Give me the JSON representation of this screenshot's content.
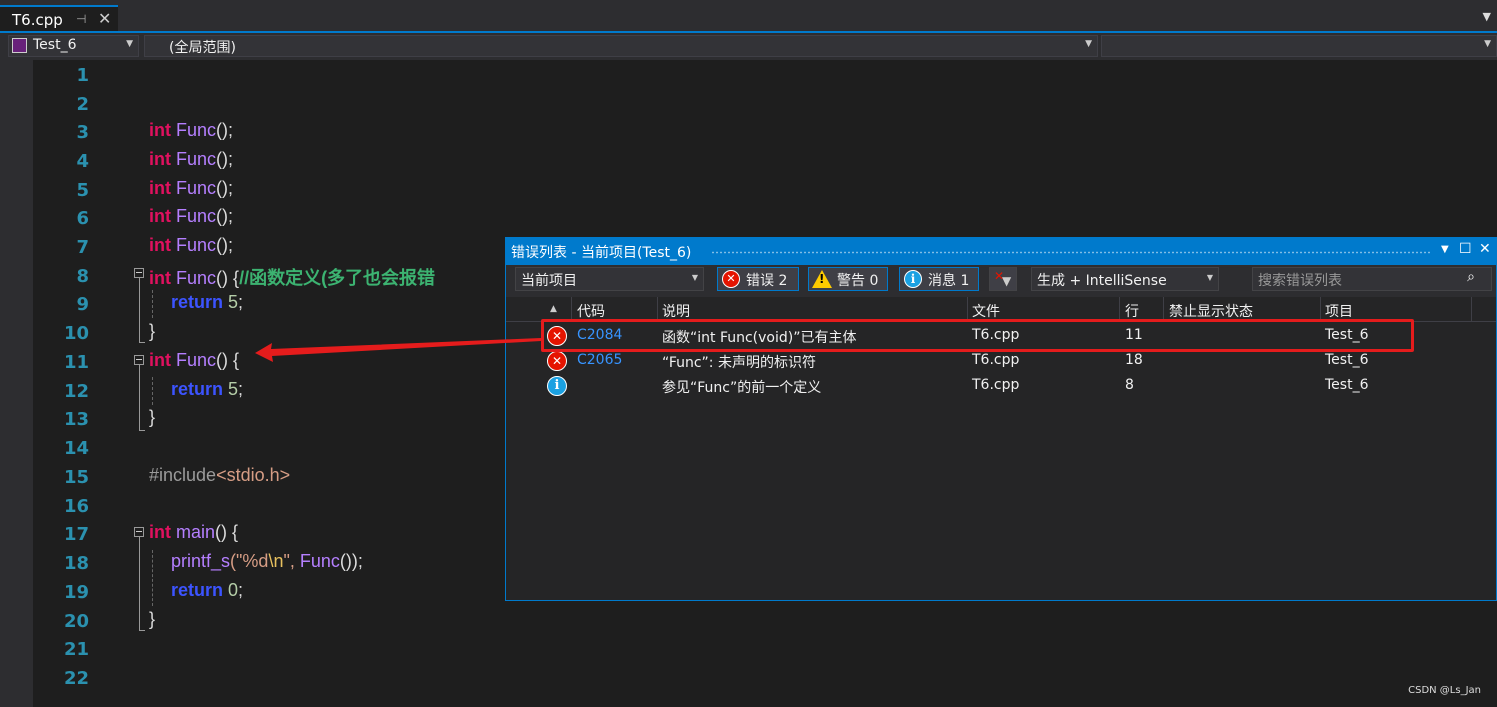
{
  "tab": {
    "title": "T6.cpp",
    "pin": "⊣",
    "close": "✕"
  },
  "nav": {
    "project": "Test_6",
    "scope": "(全局范围)",
    "member": ""
  },
  "lines": [
    "1",
    "2",
    "3",
    "4",
    "5",
    "6",
    "7",
    "8",
    "9",
    "10",
    "11",
    "12",
    "13",
    "14",
    "15",
    "16",
    "17",
    "18",
    "19",
    "20",
    "21",
    "22"
  ],
  "code": {
    "l3": {
      "kw": "int",
      "fn": "Func",
      "rest": "();"
    },
    "l4": {
      "kw": "int",
      "fn": "Func",
      "rest": "();"
    },
    "l5": {
      "kw": "int",
      "fn": "Func",
      "rest": "();"
    },
    "l6": {
      "kw": "int",
      "fn": "Func",
      "rest": "();"
    },
    "l7": {
      "kw": "int",
      "fn": "Func",
      "rest": "();"
    },
    "l8": {
      "kw": "int",
      "fn": "Func",
      "rest": "() {",
      "comment": "//函数定义(多了也会报错"
    },
    "l9": {
      "kw": "return",
      "num": "5",
      "rest": ";"
    },
    "l10": {
      "brace": "}"
    },
    "l11": {
      "kw": "int",
      "fn": "Func",
      "rest": "() {"
    },
    "l12": {
      "kw": "return",
      "num": "5",
      "rest": ";"
    },
    "l13": {
      "brace": "}"
    },
    "l15": {
      "pp": "#include",
      "inc": "<stdio.h>"
    },
    "l17": {
      "kw": "int",
      "fn": "main",
      "rest": "() {"
    },
    "l18": {
      "fn": "printf_s",
      "open": "(\"%d",
      "esc": "\\n",
      "close": "\", ",
      "fn2": "Func",
      "end": "());"
    },
    "l19": {
      "kw": "return",
      "num": "0",
      "rest": ";"
    },
    "l20": {
      "brace": "}"
    }
  },
  "error_list": {
    "title": "错误列表 - 当前项目(Test_6)",
    "scope_combo": "当前项目",
    "errors_btn": "错误 2",
    "warnings_btn": "警告 0",
    "messages_btn": "消息 1",
    "build_combo": "生成 + IntelliSense",
    "search_placeholder": "搜索错误列表",
    "columns": [
      "代码",
      "说明",
      "文件",
      "行",
      "禁止显示状态",
      "项目"
    ],
    "rows": [
      {
        "severity": "error",
        "code": "C2084",
        "desc": "函数“int Func(void)”已有主体",
        "file": "T6.cpp",
        "line": "11",
        "project": "Test_6"
      },
      {
        "severity": "error",
        "code": "C2065",
        "desc": "“Func”: 未声明的标识符",
        "file": "T6.cpp",
        "line": "18",
        "project": "Test_6"
      },
      {
        "severity": "info",
        "code": "",
        "desc": "参见“Func”的前一个定义",
        "file": "T6.cpp",
        "line": "8",
        "project": "Test_6"
      }
    ]
  },
  "watermark": "CSDN @Ls_Jan",
  "colors": {
    "accent": "#007acc",
    "keyword": "#e0115f",
    "function": "#b57fff",
    "comment": "#3cb371",
    "annotation": "#e51c1c"
  }
}
